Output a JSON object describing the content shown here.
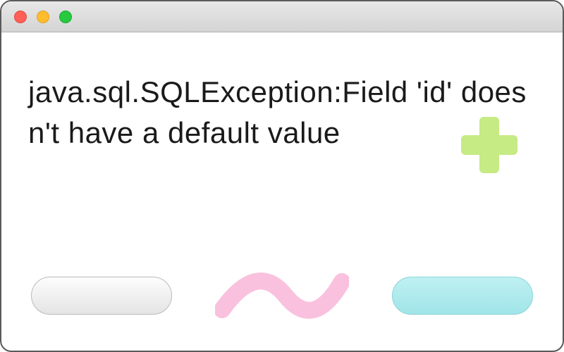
{
  "window": {
    "main_text": "java.sql.SQLException:Field 'id' doesn't have a default value"
  }
}
